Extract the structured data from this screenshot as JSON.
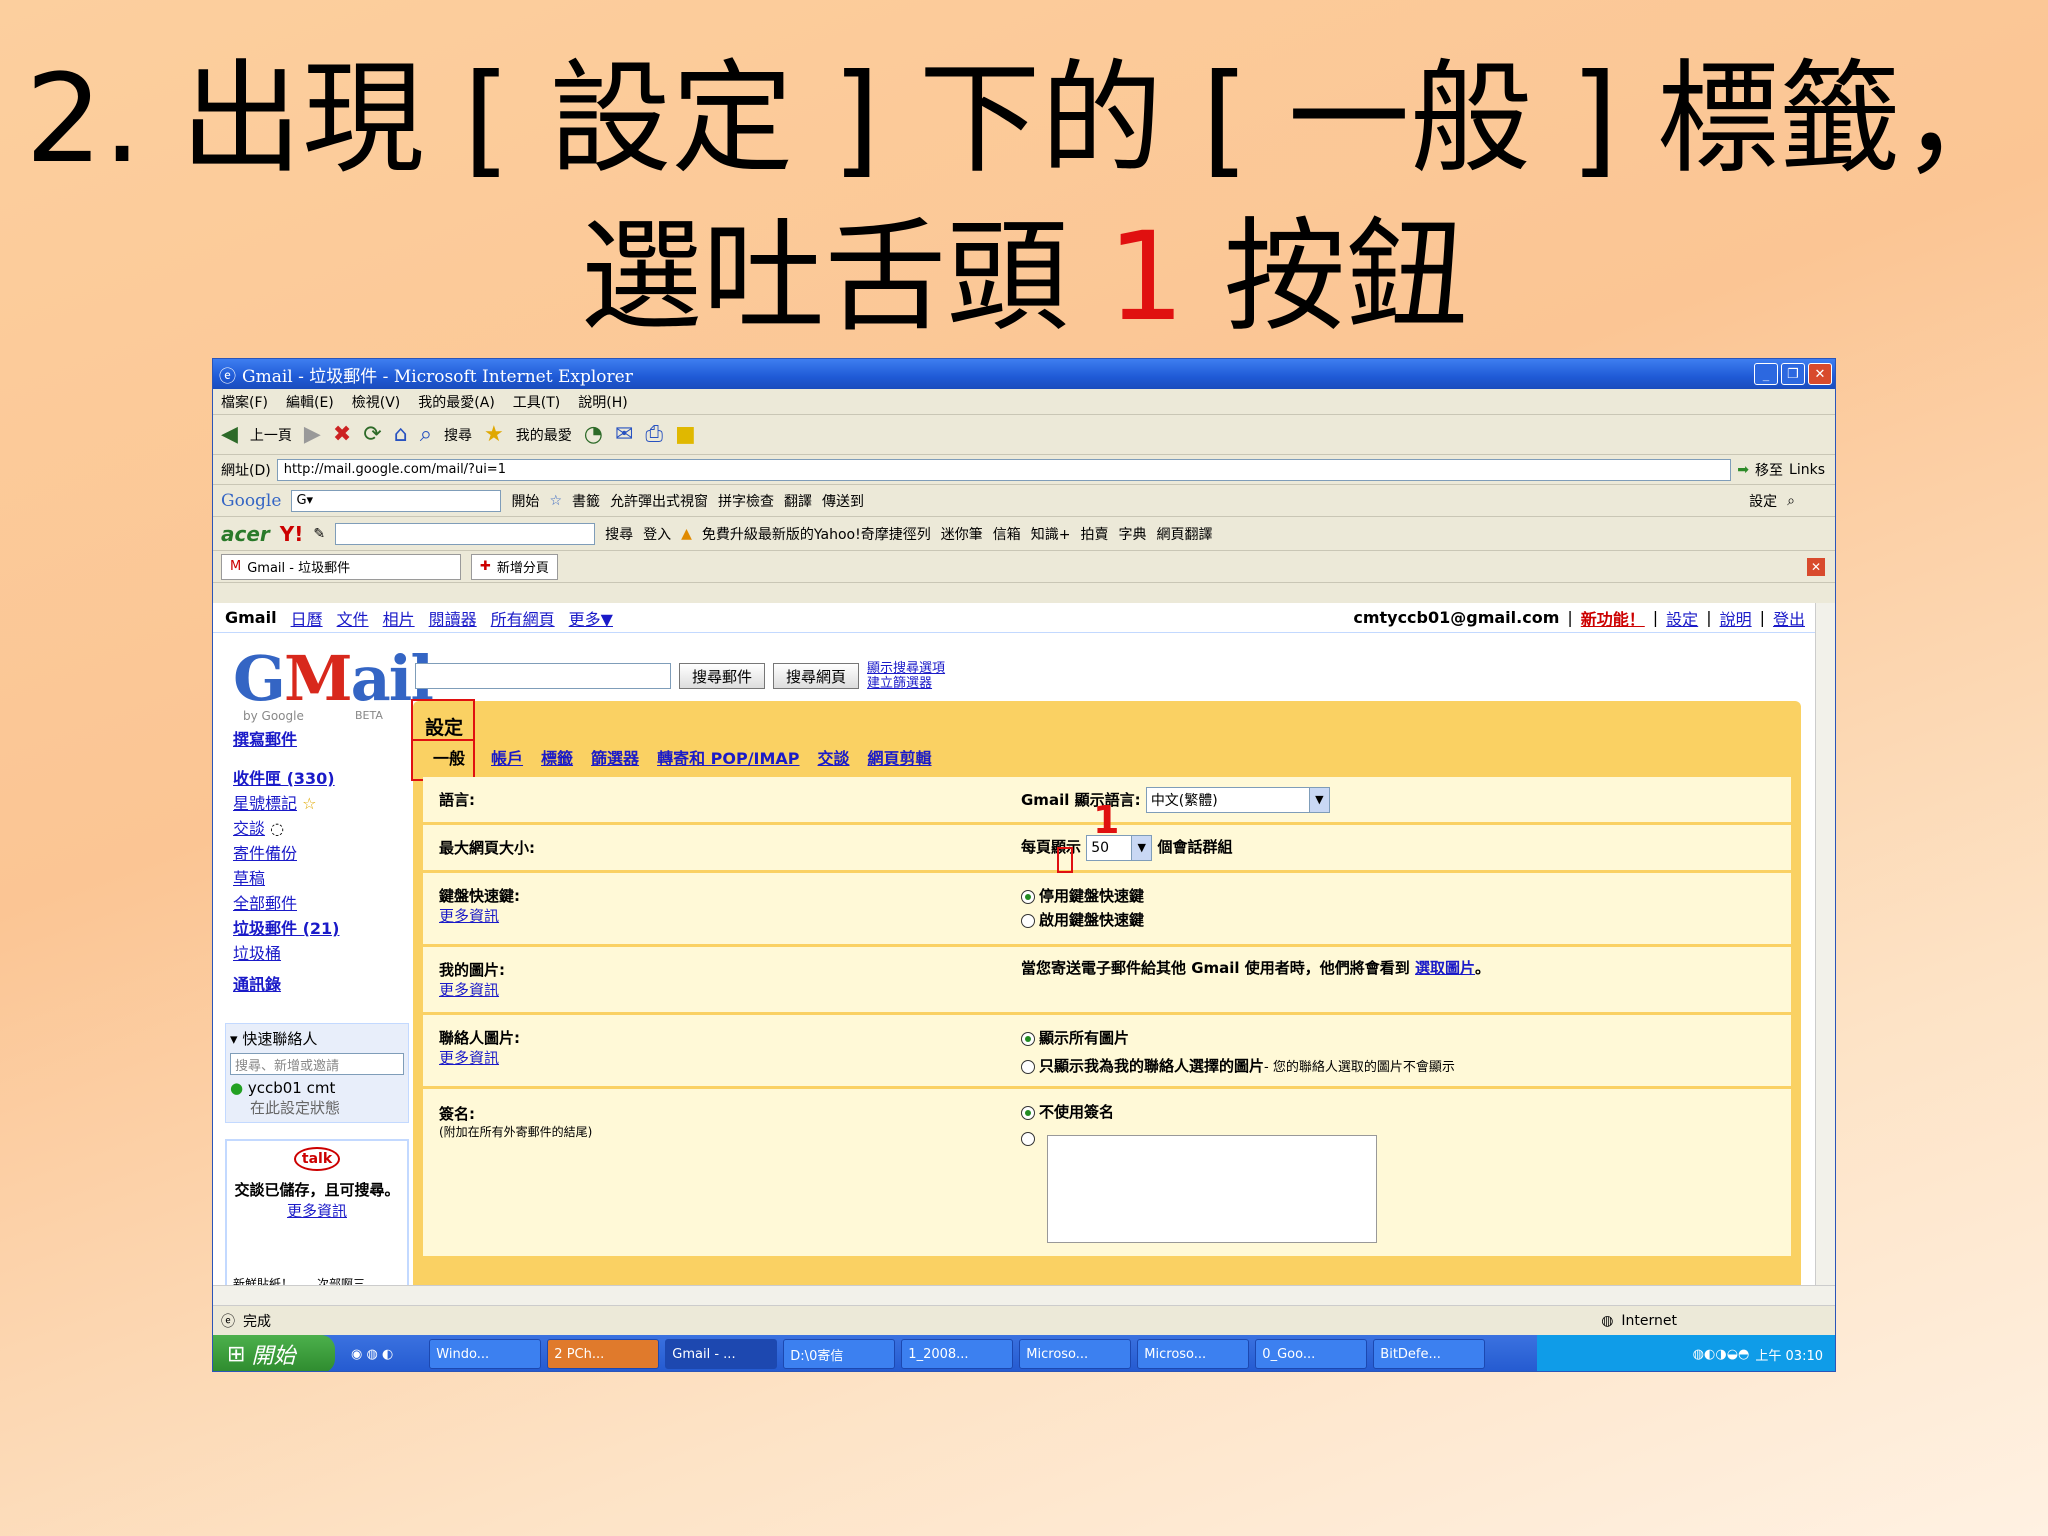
{
  "slide": {
    "line1": "2. 出現 [ 設定 ] 下的 [ 一般 ] 標籤，",
    "line2_pre": "選吐舌頭 ",
    "line2_red": "1",
    "line2_post": " 按鈕"
  },
  "browser": {
    "title": "Gmail - 垃圾郵件 - Microsoft Internet Explorer",
    "menu": [
      "檔案(F)",
      "編輯(E)",
      "檢視(V)",
      "我的最愛(A)",
      "工具(T)",
      "說明(H)"
    ],
    "toolbar": {
      "back": "上一頁",
      "search": "搜尋",
      "favorites": "我的最愛"
    },
    "address_label": "網址(D)",
    "address": "http://mail.google.com/mail/?ui=1",
    "go": "移至",
    "links": "Links",
    "google_bar": {
      "logo": "Google",
      "start": "開始",
      "bookmarks": "書籤",
      "popups": "允許彈出式視窗",
      "spell": "拼字檢查",
      "translate": "翻譯",
      "send": "傳送到",
      "settings": "設定"
    },
    "acer_bar": {
      "brand": "acer",
      "yahoo": "Y!",
      "search": "搜尋",
      "login": "登入",
      "upgrade": "免費升級最新版的Yahoo!奇摩捷徑列",
      "minipen": "迷你筆",
      "mail": "信箱",
      "knowledge": "知識+",
      "auction": "拍賣",
      "dict": "字典",
      "web_translate": "網頁翻譯"
    },
    "tab": "Gmail - 垃圾郵件",
    "new_tab": "新增分頁",
    "status": "完成",
    "zone": "Internet"
  },
  "gmail": {
    "topnav": [
      "Gmail",
      "日曆",
      "文件",
      "相片",
      "閱讀器",
      "所有網頁",
      "更多▼"
    ],
    "account": "cmtyccb01@gmail.com",
    "new_features": "新功能！",
    "settings": "設定",
    "help": "說明",
    "logout": "登出",
    "logo_g": "G",
    "logo_m": "M",
    "logo_rest": "ail",
    "bygoogle": "by Google",
    "beta": "BETA",
    "search_mail": "搜尋郵件",
    "search_web": "搜尋網頁",
    "show_options": "顯示搜尋選項",
    "create_filter": "建立篩選器",
    "compose": "撰寫郵件",
    "nav": [
      "收件匣 (330)",
      "星號標記",
      "交談",
      "寄件備份",
      "草稿",
      "全部郵件",
      "垃圾郵件 (21)",
      "垃圾桶",
      "通訊錄"
    ],
    "quick_contacts": "快速聯絡人",
    "qc_placeholder": "搜尋、新增或邀請",
    "contact": "yccb01 cmt",
    "contact_status": "在此設定狀態",
    "talk_logo": "talk",
    "talk_saved": "交談已儲存，且可搜尋。",
    "talk_more": "更多資訊",
    "cutoff": "新鮮貼紙！　　次部啊三",
    "settings_title": "設定",
    "tabs": [
      "一般",
      "帳戶",
      "標籤",
      "篩選器",
      "轉寄和 POP/IMAP",
      "交談",
      "網頁剪輯"
    ],
    "rows": {
      "lang_label": "語言:",
      "lang_val": "Gmail 顯示語言:",
      "lang_sel": "中文(繁體)",
      "size_label": "最大網頁大小:",
      "size_pre": "每頁顯示",
      "size_sel": "50",
      "size_post": "個會話群組",
      "keys_label": "鍵盤快速鍵:",
      "more": "更多資訊",
      "keys_off": "停用鍵盤快速鍵",
      "keys_on": "啟用鍵盤快速鍵",
      "pic_label": "我的圖片:",
      "pic_val": "當您寄送電子郵件給其他 Gmail 使用者時，他們將會看到",
      "pic_link": "選取圖片",
      "cpic_label": "聯絡人圖片:",
      "cpic_all": "顯示所有圖片",
      "cpic_mine": "只顯示我為我的聯絡人選擇的圖片",
      "cpic_note": "- 您的聯絡人選取的圖片不會顯示",
      "sig_label": "簽名:",
      "sig_sub": "(附加在所有外寄郵件的結尾)",
      "sig_none": "不使用簽名"
    },
    "marker": "1"
  },
  "taskbar": {
    "start": "開始",
    "tasks": [
      "Windo...",
      "2 PCh...",
      "Gmail - ...",
      "D:\\0寄信",
      "1_2008...",
      "Microso...",
      "Microso...",
      "0_Goo...",
      "BitDefe..."
    ],
    "clock": "上午 03:10"
  }
}
